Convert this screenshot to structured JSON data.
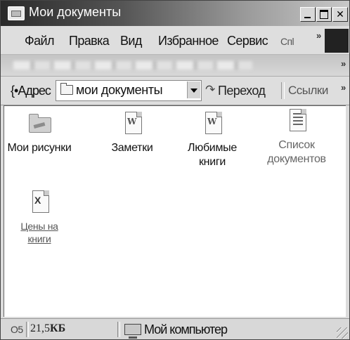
{
  "window": {
    "title": "Мои документы",
    "icon": "folder-window-icon"
  },
  "title_buttons": {
    "minimize": "minimize-icon",
    "maximize": "maximize-icon",
    "close": "close-icon"
  },
  "menu": {
    "items": [
      "Файл",
      "Правка",
      "Вид",
      "Избранное",
      "Сервис",
      "Cпl"
    ],
    "overflow": "»"
  },
  "toolbar": {
    "overflow": "»"
  },
  "address_bar": {
    "label": "{•Адрес",
    "value": "мои документы",
    "go_label": "Переход",
    "links_label": "Ссылки",
    "overflow": "»"
  },
  "files": [
    {
      "name_lines": [
        "Мои рисунки"
      ],
      "icon": "pictures-folder-icon"
    },
    {
      "name_lines": [
        "Заметки"
      ],
      "icon": "word-document-icon",
      "badge": "W"
    },
    {
      "name_lines": [
        "Любимые",
        "книги"
      ],
      "icon": "word-document-icon",
      "badge": "W"
    },
    {
      "name_lines": [
        "Список",
        "документов"
      ],
      "icon": "text-document-icon"
    },
    {
      "name_lines": [
        "Цены на",
        "книги"
      ],
      "icon": "excel-workbook-icon",
      "badge": "X"
    }
  ],
  "status_bar": {
    "objects": "О5",
    "size_value": "21,5",
    "size_unit": "КБ",
    "zone": "Мой компьютер"
  }
}
